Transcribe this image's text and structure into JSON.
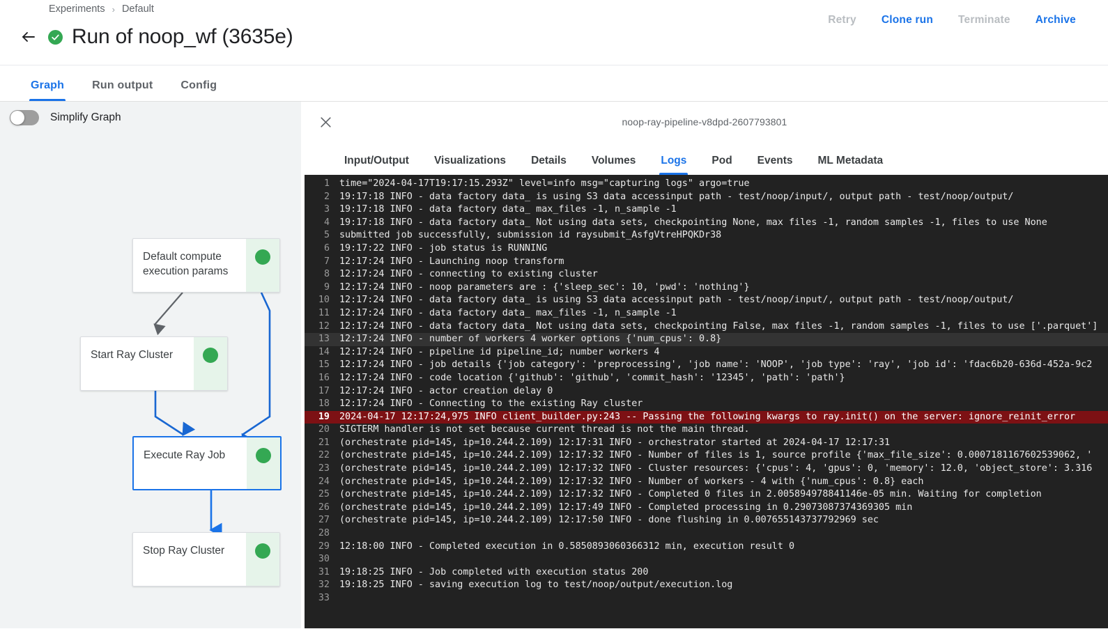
{
  "breadcrumb": {
    "items": [
      "Experiments",
      "Default"
    ],
    "separator": "›"
  },
  "header": {
    "title": "Run of noop_wf (3635e)",
    "status_icon": "check-circle-icon",
    "back_icon": "back-arrow-icon",
    "actions": [
      {
        "label": "Retry",
        "enabled": false
      },
      {
        "label": "Clone run",
        "enabled": true
      },
      {
        "label": "Terminate",
        "enabled": false
      },
      {
        "label": "Archive",
        "enabled": true
      }
    ]
  },
  "main_tabs": [
    {
      "label": "Graph",
      "active": true
    },
    {
      "label": "Run output",
      "active": false
    },
    {
      "label": "Config",
      "active": false
    }
  ],
  "graph": {
    "simplify_toggle_label": "Simplify Graph",
    "simplify_toggle_on": false,
    "nodes": [
      {
        "id": "default-compute",
        "label": "Default compute execution params",
        "status": "succeeded",
        "selected": false
      },
      {
        "id": "start-ray-cluster",
        "label": "Start Ray Cluster",
        "status": "succeeded",
        "selected": false
      },
      {
        "id": "execute-ray-job",
        "label": "Execute Ray Job",
        "status": "succeeded",
        "selected": true
      },
      {
        "id": "stop-ray-cluster",
        "label": "Stop Ray Cluster",
        "status": "succeeded",
        "selected": false
      }
    ]
  },
  "side_panel": {
    "close_icon": "close-icon",
    "pod_name": "noop-ray-pipeline-v8dpd-2607793801",
    "tabs": [
      {
        "label": "Input/Output",
        "active": false
      },
      {
        "label": "Visualizations",
        "active": false
      },
      {
        "label": "Details",
        "active": false
      },
      {
        "label": "Volumes",
        "active": false
      },
      {
        "label": "Logs",
        "active": true
      },
      {
        "label": "Pod",
        "active": false
      },
      {
        "label": "Events",
        "active": false
      },
      {
        "label": "ML Metadata",
        "active": false
      }
    ],
    "logs": [
      {
        "n": 1,
        "text": "time=\"2024-04-17T19:17:15.293Z\" level=info msg=\"capturing logs\" argo=true",
        "style": "normal"
      },
      {
        "n": 2,
        "text": "19:17:18 INFO - data factory data_ is using S3 data accessinput path - test/noop/input/, output path - test/noop/output/",
        "style": "normal"
      },
      {
        "n": 3,
        "text": "19:17:18 INFO - data factory data_ max_files -1, n_sample -1",
        "style": "normal"
      },
      {
        "n": 4,
        "text": "19:17:18 INFO - data factory data_ Not using data sets, checkpointing None, max files -1, random samples -1, files to use None",
        "style": "normal"
      },
      {
        "n": 5,
        "text": "submitted job successfully, submission id raysubmit_AsfgVtreHPQKDr38",
        "style": "normal"
      },
      {
        "n": 6,
        "text": "19:17:22 INFO - job status is RUNNING",
        "style": "normal"
      },
      {
        "n": 7,
        "text": "12:17:24 INFO - Launching noop transform",
        "style": "normal"
      },
      {
        "n": 8,
        "text": "12:17:24 INFO - connecting to existing cluster",
        "style": "normal"
      },
      {
        "n": 9,
        "text": "12:17:24 INFO - noop parameters are : {'sleep_sec': 10, 'pwd': 'nothing'}",
        "style": "normal"
      },
      {
        "n": 10,
        "text": "12:17:24 INFO - data factory data_ is using S3 data accessinput path - test/noop/input/, output path - test/noop/output/",
        "style": "normal"
      },
      {
        "n": 11,
        "text": "12:17:24 INFO - data factory data_ max_files -1, n_sample -1",
        "style": "normal"
      },
      {
        "n": 12,
        "text": "12:17:24 INFO - data factory data_ Not using data sets, checkpointing False, max files -1, random samples -1, files to use ['.parquet']",
        "style": "normal"
      },
      {
        "n": 13,
        "text": "12:17:24 INFO - number of workers 4 worker options {'num_cpus': 0.8}",
        "style": "highlight"
      },
      {
        "n": 14,
        "text": "12:17:24 INFO - pipeline id pipeline_id; number workers 4",
        "style": "normal"
      },
      {
        "n": 15,
        "text": "12:17:24 INFO - job details {'job category': 'preprocessing', 'job name': 'NOOP', 'job type': 'ray', 'job id': 'fdac6b20-636d-452a-9c2",
        "style": "normal"
      },
      {
        "n": 16,
        "text": "12:17:24 INFO - code location {'github': 'github', 'commit_hash': '12345', 'path': 'path'}",
        "style": "normal"
      },
      {
        "n": 17,
        "text": "12:17:24 INFO - actor creation delay 0",
        "style": "normal"
      },
      {
        "n": 18,
        "text": "12:17:24 INFO - Connecting to the existing Ray cluster",
        "style": "normal"
      },
      {
        "n": 19,
        "text": "2024-04-17 12:17:24,975 INFO client_builder.py:243 -- Passing the following kwargs to ray.init() on the server: ignore_reinit_error",
        "style": "error"
      },
      {
        "n": 20,
        "text": "SIGTERM handler is not set because current thread is not the main thread.",
        "style": "normal"
      },
      {
        "n": 21,
        "text": "(orchestrate pid=145, ip=10.244.2.109) 12:17:31 INFO - orchestrator started at 2024-04-17 12:17:31",
        "style": "normal"
      },
      {
        "n": 22,
        "text": "(orchestrate pid=145, ip=10.244.2.109) 12:17:32 INFO - Number of files is 1, source profile {'max_file_size': 0.0007181167602539062, '",
        "style": "normal"
      },
      {
        "n": 23,
        "text": "(orchestrate pid=145, ip=10.244.2.109) 12:17:32 INFO - Cluster resources: {'cpus': 4, 'gpus': 0, 'memory': 12.0, 'object_store': 3.316",
        "style": "normal"
      },
      {
        "n": 24,
        "text": "(orchestrate pid=145, ip=10.244.2.109) 12:17:32 INFO - Number of workers - 4 with {'num_cpus': 0.8} each",
        "style": "normal"
      },
      {
        "n": 25,
        "text": "(orchestrate pid=145, ip=10.244.2.109) 12:17:32 INFO - Completed 0 files in 2.005894978841146e-05 min. Waiting for completion",
        "style": "normal"
      },
      {
        "n": 26,
        "text": "(orchestrate pid=145, ip=10.244.2.109) 12:17:49 INFO - Completed processing in 0.29073087374369305 min",
        "style": "normal"
      },
      {
        "n": 27,
        "text": "(orchestrate pid=145, ip=10.244.2.109) 12:17:50 INFO - done flushing in 0.007655143737792969 sec",
        "style": "normal"
      },
      {
        "n": 28,
        "text": "",
        "style": "normal"
      },
      {
        "n": 29,
        "text": "12:18:00 INFO - Completed execution in 0.5850893060366312 min, execution result 0",
        "style": "normal"
      },
      {
        "n": 30,
        "text": "",
        "style": "normal"
      },
      {
        "n": 31,
        "text": "19:18:25 INFO - Job completed with execution status 200",
        "style": "normal"
      },
      {
        "n": 32,
        "text": "19:18:25 INFO - saving execution log to test/noop/output/execution.log",
        "style": "normal"
      },
      {
        "n": 33,
        "text": "",
        "style": "normal"
      }
    ]
  },
  "colors": {
    "accent": "#1a73e8",
    "success": "#34a853",
    "success_bg": "#e6f4ea",
    "log_bg": "#222222",
    "log_error_bg": "#7d1114",
    "graph_bg": "#f1f3f4",
    "disabled_text": "#b9bdc1"
  }
}
